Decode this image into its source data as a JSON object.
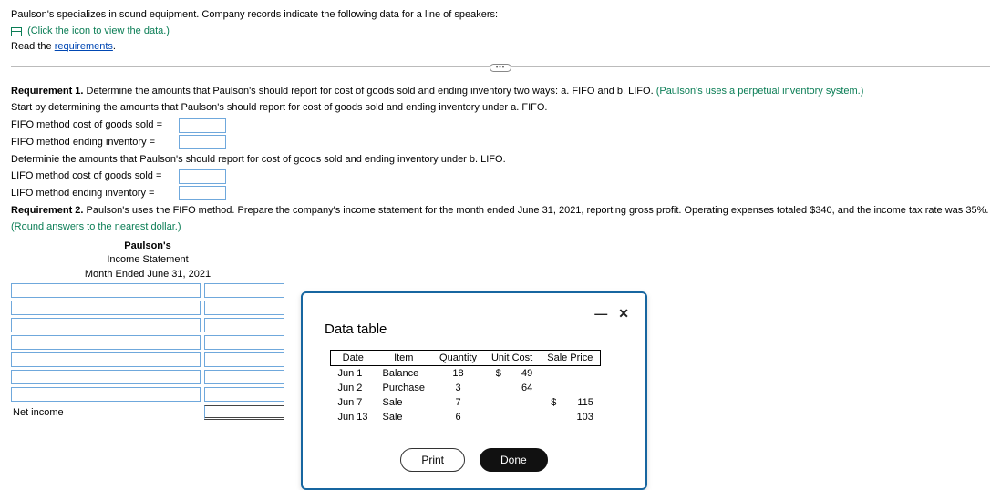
{
  "intro": {
    "line1": "Paulson's specializes in sound equipment. Company records indicate the following data for a line of speakers:",
    "click_data": "(Click the icon to view the data.)",
    "read_the": "Read the ",
    "requirements_link": "requirements",
    "period": "."
  },
  "req1": {
    "heading_bold": "Requirement 1.",
    "heading_rest": " Determine the amounts that Paulson's should report for cost of goods sold and ending inventory two ways: a. FIFO and b. LIFO. ",
    "heading_paren": "(Paulson's uses a perpetual inventory system.)",
    "start_fifo": "Start by determining the amounts that Paulson's should report for cost of goods sold and ending inventory under a. FIFO.",
    "fifo_cogs_label": "FIFO method cost of goods sold =",
    "fifo_ei_label": "FIFO method ending inventory =",
    "determine_lifo": "Determinie the amounts that Paulson's should report for cost of goods sold and ending inventory under b. LIFO.",
    "lifo_cogs_label": "LIFO method cost of goods sold =",
    "lifo_ei_label": "LIFO method ending inventory ="
  },
  "req2": {
    "heading_bold": "Requirement 2.",
    "heading_rest": " Paulson's uses the FIFO method. Prepare the company's income statement for the month ended June 31, 2021, reporting gross profit. Operating expenses totaled $340, and the income tax rate was 35%. ",
    "heading_paren": "(Round answers to the nearest dollar.)"
  },
  "statement": {
    "company": "Paulson's",
    "title": "Income Statement",
    "period": "Month Ended June 31, 2021",
    "net_income_label": "Net income"
  },
  "modal": {
    "title": "Data table",
    "headers": {
      "date": "Date",
      "item": "Item",
      "qty": "Quantity",
      "unit_cost": "Unit Cost",
      "sale_price": "Sale Price"
    },
    "rows": [
      {
        "date": "Jun 1",
        "item": "Balance",
        "qty": "18",
        "uc_sym": "$",
        "uc": "49",
        "sp_sym": "",
        "sp": ""
      },
      {
        "date": "Jun 2",
        "item": "Purchase",
        "qty": "3",
        "uc_sym": "",
        "uc": "64",
        "sp_sym": "",
        "sp": ""
      },
      {
        "date": "Jun 7",
        "item": "Sale",
        "qty": "7",
        "uc_sym": "",
        "uc": "",
        "sp_sym": "$",
        "sp": "115"
      },
      {
        "date": "Jun 13",
        "item": "Sale",
        "qty": "6",
        "uc_sym": "",
        "uc": "",
        "sp_sym": "",
        "sp": "103"
      }
    ],
    "print": "Print",
    "done": "Done",
    "minimize": "—",
    "close": "✕"
  },
  "chart_data": {
    "type": "table",
    "title": "Data table",
    "columns": [
      "Date",
      "Item",
      "Quantity",
      "Unit Cost",
      "Sale Price"
    ],
    "rows": [
      [
        "Jun 1",
        "Balance",
        18,
        49,
        null
      ],
      [
        "Jun 2",
        "Purchase",
        3,
        64,
        null
      ],
      [
        "Jun 7",
        "Sale",
        7,
        null,
        115
      ],
      [
        "Jun 13",
        "Sale",
        6,
        null,
        103
      ]
    ]
  }
}
